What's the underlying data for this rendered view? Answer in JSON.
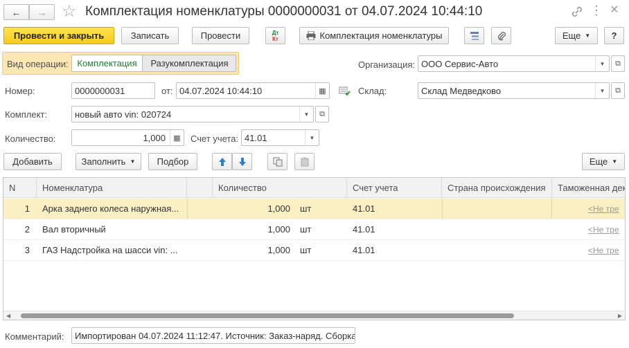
{
  "header": {
    "title": "Комплектация номенклатуры 0000000031 от 04.07.2024 10:44:10",
    "back_glyph": "←",
    "forward_glyph": "→",
    "star_glyph": "☆",
    "link_glyph": "🔗",
    "more_glyph": "⋮",
    "close_glyph": "×"
  },
  "toolbar": {
    "post_close": "Провести и закрыть",
    "write": "Записать",
    "post": "Провести",
    "dtkt_top": "Дт",
    "dtkt_bottom": "Кт",
    "print_label": "Комплектация номенклатуры",
    "more": "Еще",
    "help": "?"
  },
  "operation": {
    "label": "Вид операции:",
    "options": [
      "Комплектация",
      "Разукомплектация"
    ],
    "selected": "Комплектация"
  },
  "form": {
    "org_label": "Организация:",
    "org_value": "ООО Сервис-Авто",
    "number_label": "Номер:",
    "number_value": "0000000031",
    "date_label": "от:",
    "date_value": "04.07.2024 10:44:10",
    "warehouse_label": "Склад:",
    "warehouse_value": "Склад Медведково",
    "kit_label": "Комплект:",
    "kit_value": "новый авто vin: 020724",
    "qty_label": "Количество:",
    "qty_value": "1,000",
    "account_label": "Счет учета:",
    "account_value": "41.01",
    "comment_label": "Комментарий:",
    "comment_value": "Импортирован 04.07.2024 11:12:47. Источник: Заказ-наряд. Сборка"
  },
  "table_toolbar": {
    "add": "Добавить",
    "fill": "Заполнить",
    "selection": "Подбор",
    "more": "Еще"
  },
  "table": {
    "columns": [
      "N",
      "Номенклатура",
      "Количество",
      "Счет учета",
      "Страна происхождения",
      "Таможенная дек"
    ],
    "rows": [
      {
        "n": "1",
        "name": "Арка заднего колеса наружная...",
        "qty": "1,000",
        "unit": "шт",
        "account": "41.01",
        "customs": "<Не тре"
      },
      {
        "n": "2",
        "name": "Вал вторичный",
        "qty": "1,000",
        "unit": "шт",
        "account": "41.01",
        "customs": "<Не тре"
      },
      {
        "n": "3",
        "name": "ГАЗ Надстройка на шасси vin: ...",
        "qty": "1,000",
        "unit": "шт",
        "account": "41.01",
        "customs": "<Не тре"
      }
    ],
    "selected_row": 1
  },
  "colors": {
    "primary": "#f5cc1e",
    "selected_row": "#fbf0c4",
    "operation_frame": "#f8d98a",
    "accent_green": "#1e7e34"
  }
}
